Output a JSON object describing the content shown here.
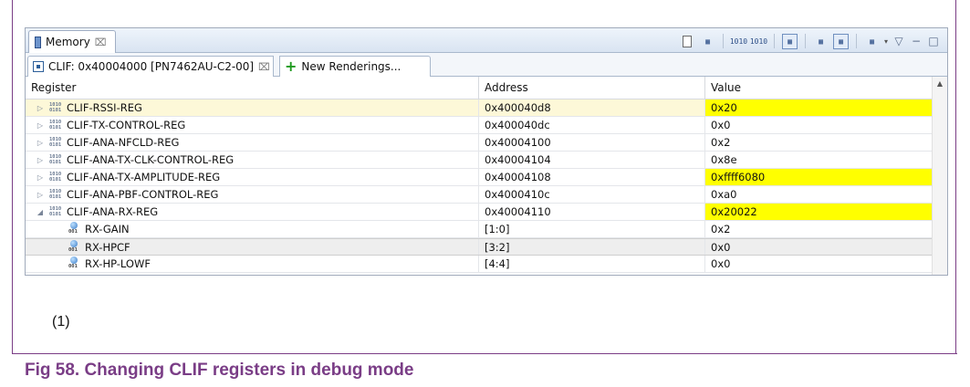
{
  "view": {
    "tab_label": "Memory",
    "close_glyph": "⌧",
    "toolbar": [
      {
        "name": "new-rendering-doc-icon"
      },
      {
        "name": "export-icon"
      },
      {
        "name": "binary-format-icon",
        "text": "1010"
      },
      {
        "name": "binary-format-alt-icon",
        "text": "1010"
      },
      {
        "name": "link-rendering-icon",
        "boxed": true
      },
      {
        "name": "grid-layout-icon"
      },
      {
        "name": "swap-pane-icon",
        "boxed": true
      },
      {
        "name": "layout-menu-icon"
      }
    ],
    "dropdown_glyph": "▾",
    "view_menu_glyph": "▽",
    "minimize_glyph": "−",
    "maximize_glyph": "□"
  },
  "renderings": {
    "active_label": "CLIF: 0x40004000 [PN7462AU-C2-00]",
    "new_label": "New Renderings..."
  },
  "table": {
    "headers": [
      "Register",
      "Address",
      "Value"
    ],
    "rows": [
      {
        "name": "CLIF-RSSI-REG",
        "address": "0x400040d8",
        "value": "0x20",
        "kind": "register",
        "expanded": false,
        "changed": true,
        "selected": true
      },
      {
        "name": "CLIF-TX-CONTROL-REG",
        "address": "0x400040dc",
        "value": "0x0",
        "kind": "register",
        "expanded": false,
        "changed": false
      },
      {
        "name": "CLIF-ANA-NFCLD-REG",
        "address": "0x40004100",
        "value": "0x2",
        "kind": "register",
        "expanded": false,
        "changed": false
      },
      {
        "name": "CLIF-ANA-TX-CLK-CONTROL-REG",
        "address": "0x40004104",
        "value": "0x8e",
        "kind": "register",
        "expanded": false,
        "changed": false
      },
      {
        "name": "CLIF-ANA-TX-AMPLITUDE-REG",
        "address": "0x40004108",
        "value": "0xffff6080",
        "kind": "register",
        "expanded": false,
        "changed": true
      },
      {
        "name": "CLIF-ANA-PBF-CONTROL-REG",
        "address": "0x4000410c",
        "value": "0xa0",
        "kind": "register",
        "expanded": false,
        "changed": false
      },
      {
        "name": "CLIF-ANA-RX-REG",
        "address": "0x40004110",
        "value": "0x20022",
        "kind": "register",
        "expanded": true,
        "changed": true
      },
      {
        "name": "RX-GAIN",
        "address": "[1:0]",
        "value": "0x2",
        "kind": "field",
        "changed": false
      },
      {
        "name": "RX-HPCF",
        "address": "[3:2]",
        "value": "0x0",
        "kind": "field",
        "changed": false,
        "hover": true
      },
      {
        "name": "RX-HP-LOWF",
        "address": "[4:4]",
        "value": "0x0",
        "kind": "field",
        "changed": false
      }
    ]
  },
  "glyphs": {
    "collapsed": "▷",
    "expanded": "◢",
    "register_icon_text": "1010\n0101",
    "field_icon_text": "001",
    "scroll_up": "▲"
  },
  "footnote": "(1)",
  "caption": "Fig 58.   Changing CLIF registers in debug mode",
  "colors": {
    "frame": "#7a3d86",
    "changed_value": "#ffff00",
    "selected_row": "#fdf8d8"
  }
}
